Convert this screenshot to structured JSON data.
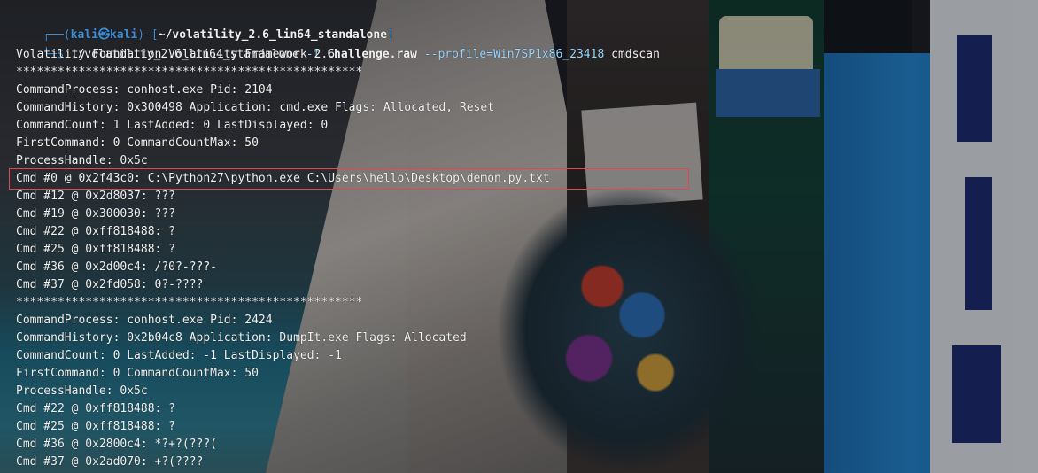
{
  "prompt": {
    "corner_top": "┌──(",
    "user": "kali",
    "sep": "㉿",
    "host": "kali",
    "mid": ")-[",
    "path": "~/volatility_2.6_lin64_standalone",
    "end": "]",
    "corner_bottom": "└─$",
    "command_exe": "./volatility_2.6_lin64_standalone",
    "command_flag_f": "-f",
    "command_file": "Challenge.raw",
    "command_profile": "--profile=Win7SP1x86_23418",
    "command_plugin": "cmdscan"
  },
  "output": [
    "Volatility Foundation Volatility Framework 2.6",
    "**************************************************",
    "CommandProcess: conhost.exe Pid: 2104",
    "CommandHistory: 0x300498 Application: cmd.exe Flags: Allocated, Reset",
    "CommandCount: 1 LastAdded: 0 LastDisplayed: 0",
    "FirstCommand: 0 CommandCountMax: 50",
    "ProcessHandle: 0x5c",
    "Cmd #0 @ 0x2f43c0: C:\\Python27\\python.exe C:\\Users\\hello\\Desktop\\demon.py.txt",
    "Cmd #12 @ 0x2d8037: ???",
    "Cmd #19 @ 0x300030: ???",
    "Cmd #22 @ 0xff818488: ?",
    "Cmd #25 @ 0xff818488: ?",
    "Cmd #36 @ 0x2d00c4: /?0?-???-",
    "Cmd #37 @ 0x2fd058: 0?-????",
    "**************************************************",
    "CommandProcess: conhost.exe Pid: 2424",
    "CommandHistory: 0x2b04c8 Application: DumpIt.exe Flags: Allocated",
    "CommandCount: 0 LastAdded: -1 LastDisplayed: -1",
    "FirstCommand: 0 CommandCountMax: 50",
    "ProcessHandle: 0x5c",
    "Cmd #22 @ 0xff818488: ?",
    "Cmd #25 @ 0xff818488: ?",
    "Cmd #36 @ 0x2800c4: *?+?(???(",
    "Cmd #37 @ 0x2ad070: +?(????"
  ],
  "colors": {
    "prompt_blue": "#3a8fd6",
    "highlight_box": "#e2474b",
    "text": "#f2f2f2"
  }
}
